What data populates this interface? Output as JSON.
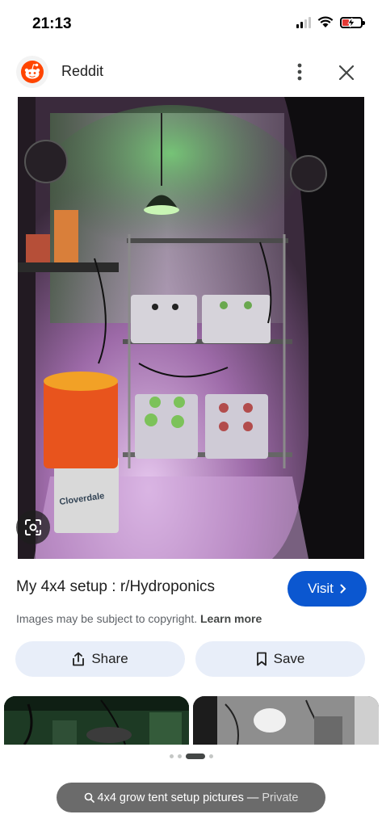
{
  "status_bar": {
    "time": "21:13"
  },
  "header": {
    "site_name": "Reddit",
    "icons": [
      "reddit-logo-icon",
      "more-vert-icon",
      "close-icon"
    ]
  },
  "result": {
    "title": "My 4x4 setup : r/Hydroponics",
    "visit_label": "Visit",
    "copyright_text": "Images may be subject to copyright.",
    "learn_more_label": "Learn more",
    "share_label": "Share",
    "save_label": "Save"
  },
  "bucket_text": "Cloverdale",
  "bottom_bar": {
    "query": "4x4 grow tent setup pictures",
    "separator": "—",
    "mode": "Private"
  },
  "colors": {
    "accent": "#0b57d0",
    "button_bg": "#e8eef9",
    "reddit_orange": "#ff4500"
  }
}
